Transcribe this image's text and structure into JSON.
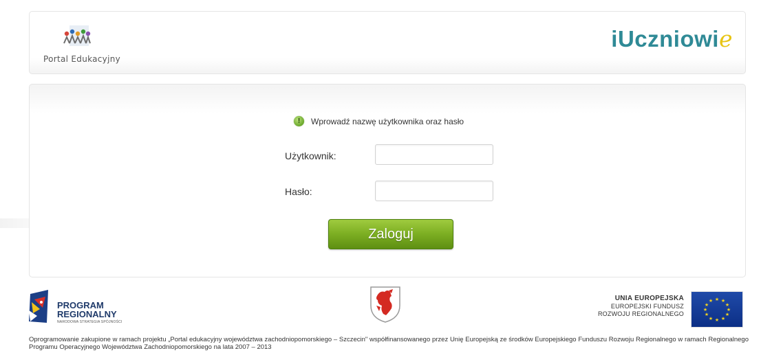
{
  "header": {
    "portal_name": "Portal Edukacyjny",
    "brand_main": "iUczniowi",
    "brand_accent": "e",
    "brand_color": "#2f8a96",
    "brand_accent_color": "#e8c514"
  },
  "login": {
    "info_icon": "exclamation-icon",
    "info_message": "Wprowadź nazwę użytkownika oraz hasło",
    "username_label": "Użytkownik:",
    "username_value": "",
    "password_label": "Hasło:",
    "password_value": "",
    "submit_label": "Zaloguj",
    "button_color": "#7cae22"
  },
  "partners": {
    "program_line1": "PROGRAM",
    "program_line2": "REGIONALNY",
    "program_sub": "NARODOWA STRATEGIA SPÓJNOŚCI",
    "eu_line1": "UNIA EUROPEJSKA",
    "eu_line2": "EUROPEJSKI FUNDUSZ",
    "eu_line3": "ROZWOJU REGIONALNEGO"
  },
  "footer": {
    "text": "Oprogramowanie zakupione w ramach projektu „Portal edukacyjny województwa zachodniopomorskiego – Szczecin\" współfinansowanego przez Unię Europejską ze środków Europejskiego Funduszu Rozwoju Regionalnego w ramach Regionalnego Programu Operacyjnego Województwa Zachodniopomorskiego na lata 2007 – 2013"
  }
}
